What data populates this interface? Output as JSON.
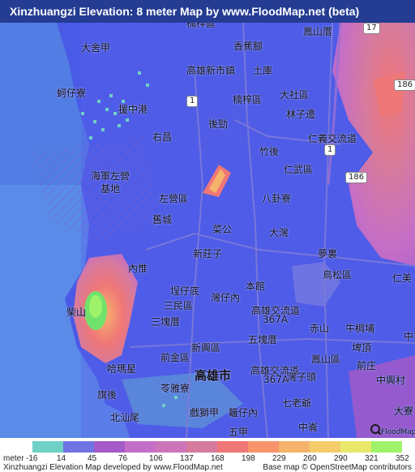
{
  "title": "Xinzhuangzi Elevation: 8 meter Map by www.FloodMap.net (beta)",
  "map_labels": [
    {
      "text": "楠梓區",
      "kind": "mid"
    },
    {
      "text": "香蕉腳",
      "kind": "mid"
    },
    {
      "text": "鳳山厝",
      "kind": "mid"
    },
    {
      "text": "大舍甲",
      "kind": "mid"
    },
    {
      "text": "高雄新市鎮",
      "kind": "mid"
    },
    {
      "text": "土庫",
      "kind": "mid"
    },
    {
      "text": "蚵仔寮",
      "kind": "mid"
    },
    {
      "text": "援中港",
      "kind": "mid"
    },
    {
      "text": "大社區",
      "kind": "mid"
    },
    {
      "text": "楠梓區",
      "kind": "mid"
    },
    {
      "text": "林子邊",
      "kind": "mid"
    },
    {
      "text": "後勁",
      "kind": "mid"
    },
    {
      "text": "右昌",
      "kind": "mid"
    },
    {
      "text": "仁義交流道",
      "kind": "mid"
    },
    {
      "text": "竹後",
      "kind": "mid"
    },
    {
      "text": "海軍左營",
      "kind": "mid"
    },
    {
      "text": "基地",
      "kind": "mid"
    },
    {
      "text": "仁武區",
      "kind": "mid"
    },
    {
      "text": "左營區",
      "kind": "mid"
    },
    {
      "text": "八卦寮",
      "kind": "mid"
    },
    {
      "text": "舊城",
      "kind": "mid"
    },
    {
      "text": "菜公",
      "kind": "mid"
    },
    {
      "text": "大灣",
      "kind": "mid"
    },
    {
      "text": "夢裏",
      "kind": "mid"
    },
    {
      "text": "新莊子",
      "kind": "mid"
    },
    {
      "text": "鳥松區",
      "kind": "mid"
    },
    {
      "text": "內惟",
      "kind": "mid"
    },
    {
      "text": "仁美",
      "kind": "mid"
    },
    {
      "text": "本館",
      "kind": "mid"
    },
    {
      "text": "埕仔底",
      "kind": "mid"
    },
    {
      "text": "灣仔內",
      "kind": "mid"
    },
    {
      "text": "三民區",
      "kind": "mid"
    },
    {
      "text": "高雄交流道",
      "kind": "mid"
    },
    {
      "text": "367A",
      "kind": "mid"
    },
    {
      "text": "柴山",
      "kind": "mid"
    },
    {
      "text": "赤山",
      "kind": "mid"
    },
    {
      "text": "牛稠埔",
      "kind": "mid"
    },
    {
      "text": "三塊厝",
      "kind": "mid"
    },
    {
      "text": "五塊厝",
      "kind": "mid"
    },
    {
      "text": "新興區",
      "kind": "mid"
    },
    {
      "text": "埤頂",
      "kind": "mid"
    },
    {
      "text": "中崙",
      "kind": "mid"
    },
    {
      "text": "前金區",
      "kind": "mid"
    },
    {
      "text": "鳳山區",
      "kind": "mid"
    },
    {
      "text": "前庄",
      "kind": "mid"
    },
    {
      "text": "哈瑪星",
      "kind": "mid"
    },
    {
      "text": "高雄市",
      "kind": "big"
    },
    {
      "text": "高雄交流道",
      "kind": "mid"
    },
    {
      "text": "367A",
      "kind": "mid"
    },
    {
      "text": "灣子頭",
      "kind": "mid"
    },
    {
      "text": "中興村",
      "kind": "mid"
    },
    {
      "text": "旗後",
      "kind": "mid"
    },
    {
      "text": "苓雅寮",
      "kind": "mid"
    },
    {
      "text": "七老爺",
      "kind": "mid"
    },
    {
      "text": "北汕尾",
      "kind": "mid"
    },
    {
      "text": "戲獅甲",
      "kind": "mid"
    },
    {
      "text": "籬仔內",
      "kind": "mid"
    },
    {
      "text": "大寮",
      "kind": "mid"
    },
    {
      "text": "中崙",
      "kind": "mid"
    },
    {
      "text": "五甲",
      "kind": "mid"
    }
  ],
  "road_shields": [
    "186",
    "186",
    "1",
    "17",
    "1"
  ],
  "legend": {
    "unit_label": "meter",
    "items": [
      {
        "value": "-16",
        "color": "#6fd0c6"
      },
      {
        "value": "14",
        "color": "#6f74e3"
      },
      {
        "value": "45",
        "color": "#a25bc9"
      },
      {
        "value": "76",
        "color": "#c56ec7"
      },
      {
        "value": "106",
        "color": "#cc75b8"
      },
      {
        "value": "137",
        "color": "#d67a9e"
      },
      {
        "value": "168",
        "color": "#f07777"
      },
      {
        "value": "198",
        "color": "#f7946c"
      },
      {
        "value": "229",
        "color": "#f6b36b"
      },
      {
        "value": "260",
        "color": "#f2cd6a"
      },
      {
        "value": "290",
        "color": "#e9e86a"
      },
      {
        "value": "321",
        "color": "#9ef36a"
      },
      {
        "value": "352",
        "color": "#71e26b"
      }
    ]
  },
  "footer_left": "Xinzhuangzi Elevation Map developed by www.FloodMap.net",
  "footer_right": "Base map © OpenStreetMap contributors",
  "logo_text": "FloodMap"
}
